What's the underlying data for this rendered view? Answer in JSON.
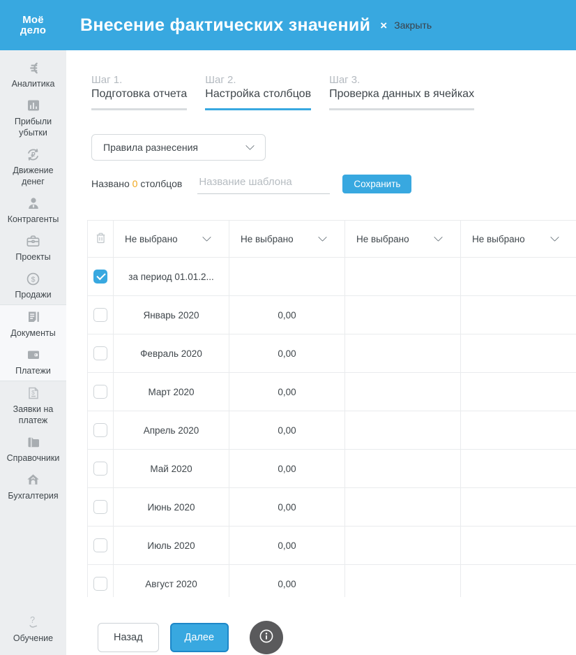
{
  "header": {
    "logo_top": "Моё",
    "logo_bottom": "дело",
    "title": "Внесение фактических значений",
    "close_x": "×",
    "close_label": "Закрыть"
  },
  "sidebar": {
    "items": [
      {
        "lines": [
          "Аналитика"
        ],
        "highlight": false
      },
      {
        "lines": [
          "Прибыли",
          "убытки"
        ],
        "highlight": false
      },
      {
        "lines": [
          "Движение",
          "денег"
        ],
        "highlight": false
      },
      {
        "lines": [
          "Контрагенты"
        ],
        "highlight": false
      },
      {
        "lines": [
          "Проекты"
        ],
        "highlight": false
      },
      {
        "lines": [
          "Продажи"
        ],
        "highlight": false
      },
      {
        "lines": [
          "Документы"
        ],
        "highlight": true
      },
      {
        "lines": [
          "Платежи"
        ],
        "highlight": true
      },
      {
        "lines": [
          "Заявки на",
          "платеж"
        ],
        "highlight": false
      },
      {
        "lines": [
          "Справочники"
        ],
        "highlight": false
      },
      {
        "lines": [
          "Бухгалтерия"
        ],
        "highlight": false
      }
    ],
    "bottom_item": {
      "lines": [
        "Обучение"
      ]
    }
  },
  "steps": [
    {
      "num": "Шаг 1.",
      "label": "Подготовка отчета",
      "active": false
    },
    {
      "num": "Шаг 2.",
      "label": "Настройка столбцов",
      "active": true
    },
    {
      "num": "Шаг 3.",
      "label": "Проверка данных в ячейках",
      "active": false
    }
  ],
  "controls": {
    "rules_dropdown_value": "Правила разнесения",
    "named_prefix": "Названо",
    "named_count": "0",
    "named_suffix": "столбцов",
    "template_name_placeholder": "Название шаблона",
    "save_button": "Сохранить"
  },
  "table": {
    "column_headers": [
      "Не выбрано",
      "Не выбрано",
      "Не выбрано",
      "Не выбрано"
    ],
    "rows": [
      {
        "checked": true,
        "cells": [
          "за период 01.01.2...",
          "",
          "",
          ""
        ]
      },
      {
        "checked": false,
        "cells": [
          "Январь 2020",
          "0,00",
          "",
          ""
        ]
      },
      {
        "checked": false,
        "cells": [
          "Февраль 2020",
          "0,00",
          "",
          ""
        ]
      },
      {
        "checked": false,
        "cells": [
          "Март 2020",
          "0,00",
          "",
          ""
        ]
      },
      {
        "checked": false,
        "cells": [
          "Апрель 2020",
          "0,00",
          "",
          ""
        ]
      },
      {
        "checked": false,
        "cells": [
          "Май 2020",
          "0,00",
          "",
          ""
        ]
      },
      {
        "checked": false,
        "cells": [
          "Июнь 2020",
          "0,00",
          "",
          ""
        ]
      },
      {
        "checked": false,
        "cells": [
          "Июль 2020",
          "0,00",
          "",
          ""
        ]
      },
      {
        "checked": false,
        "cells": [
          "Август 2020",
          "0,00",
          "",
          ""
        ]
      }
    ]
  },
  "footer": {
    "back_button": "Назад",
    "next_button": "Далее"
  },
  "colors": {
    "header_bg": "#38a8e0",
    "accent_blue": "#38a8e0",
    "count_orange": "#f0a71c",
    "next_button_border": "#1d87c8",
    "info_circle_bg": "#5a5a5c",
    "sidebar_bg": "#eceef0"
  }
}
